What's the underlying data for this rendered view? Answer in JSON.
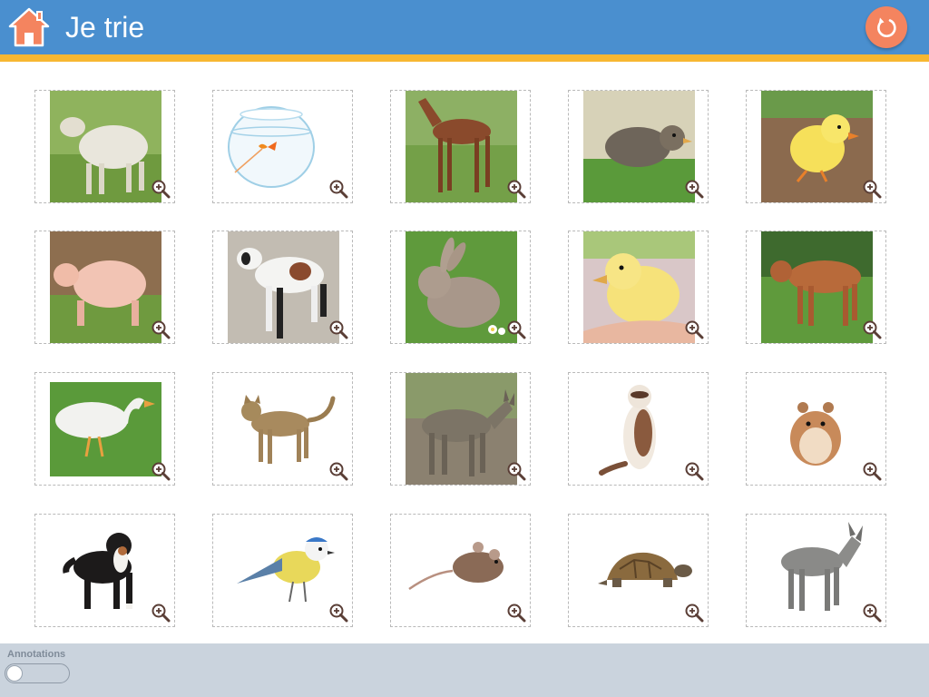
{
  "header": {
    "title": "Je trie",
    "home_icon": "home-icon",
    "reset_icon": "refresh-icon",
    "bar_color": "#4a8fcf",
    "stripe_color": "#f7b731",
    "accent_color": "#f4845f"
  },
  "cards": [
    {
      "animal": "sheep"
    },
    {
      "animal": "goldfish-bowl"
    },
    {
      "animal": "foal"
    },
    {
      "animal": "chick-speckled"
    },
    {
      "animal": "chick-yellow"
    },
    {
      "animal": "piglet"
    },
    {
      "animal": "goat-kid"
    },
    {
      "animal": "rabbit"
    },
    {
      "animal": "duckling"
    },
    {
      "animal": "calf"
    },
    {
      "animal": "goose"
    },
    {
      "animal": "cat"
    },
    {
      "animal": "donkey-brown"
    },
    {
      "animal": "ferret"
    },
    {
      "animal": "hamster"
    },
    {
      "animal": "dog"
    },
    {
      "animal": "blue-tit"
    },
    {
      "animal": "mouse"
    },
    {
      "animal": "tortoise"
    },
    {
      "animal": "donkey-grey"
    }
  ],
  "zoom_icon": "zoom-in-icon",
  "footer": {
    "annotations_label": "Annotations",
    "annotations_on": false
  }
}
